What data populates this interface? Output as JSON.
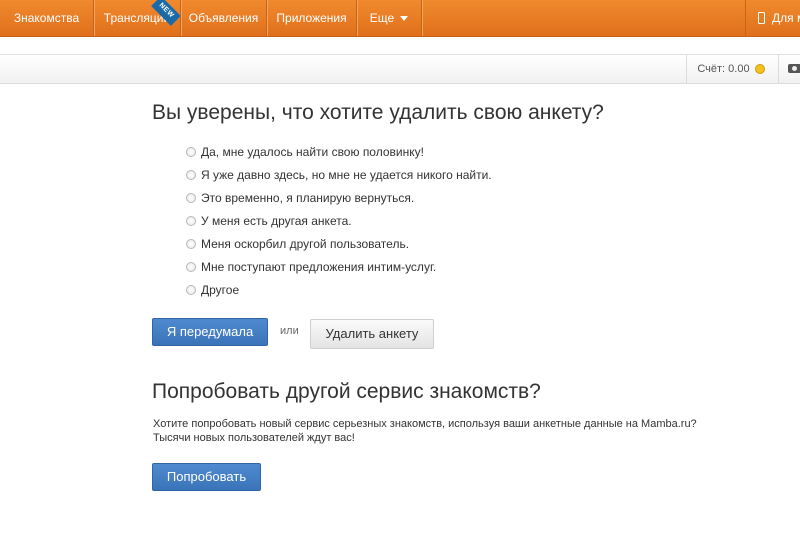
{
  "nav": {
    "items": [
      "Знакомства",
      "Трансляции",
      "Объявления",
      "Приложения",
      "Еще"
    ],
    "new_badge": "NEW",
    "mobile_label": "Для м"
  },
  "subbar": {
    "balance_label": "Счёт: 0.00"
  },
  "delete_section": {
    "title": "Вы уверены, что хотите удалить свою анкету?",
    "options": [
      "Да, мне удалось найти свою половинку!",
      "Я уже давно здесь, но мне не удается никого найти.",
      "Это временно, я планирую вернуться.",
      "У меня есть другая анкета.",
      "Меня оскорбил другой пользователь.",
      "Мне поступают предложения интим-услуг.",
      "Другое"
    ],
    "changed_mind_button": "Я передумала",
    "or_label": "или",
    "delete_button": "Удалить анкету"
  },
  "alt_section": {
    "title": "Попробовать другой сервис знакомств?",
    "line1": "Хотите попробовать новый сервис серьезных знакомств, используя ваши анкетные данные на Mamba.ru?",
    "line2": "Тысячи новых пользователей ждут вас!",
    "try_button": "Попробовать"
  },
  "colors": {
    "top_nav": "#e87a24",
    "primary_button": "#4580c4",
    "new_badge": "#1b6aa8"
  }
}
